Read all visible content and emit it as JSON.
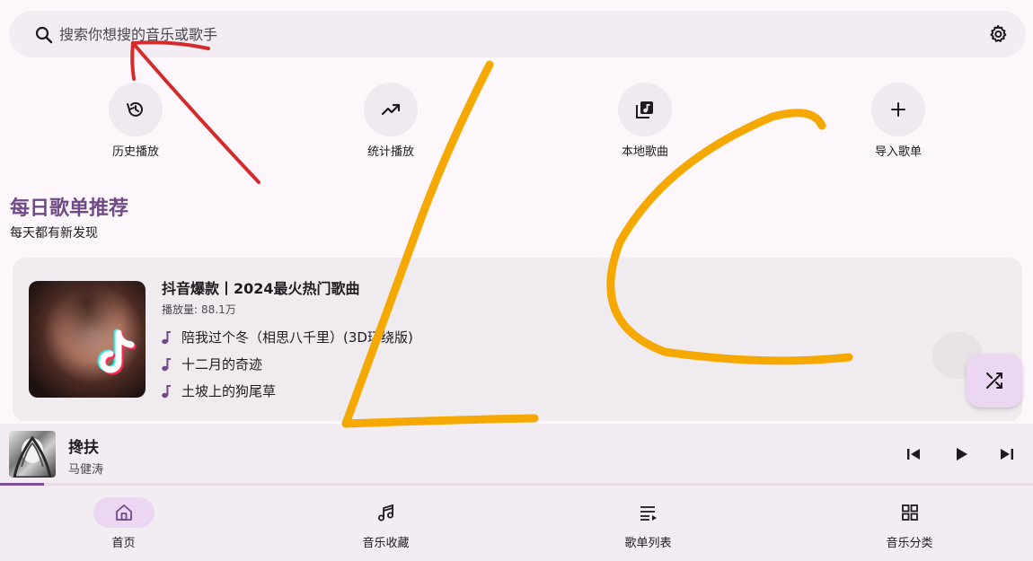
{
  "search": {
    "placeholder": "搜索你想搜的音乐或歌手",
    "icon": "search-icon",
    "settings_icon": "gear-icon"
  },
  "quick_actions": [
    {
      "label": "历史播放",
      "icon": "history-icon"
    },
    {
      "label": "统计播放",
      "icon": "trending-up-icon"
    },
    {
      "label": "本地歌曲",
      "icon": "library-music-icon"
    },
    {
      "label": "导入歌单",
      "icon": "plus-icon"
    }
  ],
  "daily": {
    "title": "每日歌单推荐",
    "subtitle": "每天都有新发现"
  },
  "playlist": {
    "title": "抖音爆款丨2024最火热门歌曲",
    "play_count_label": "播放量:",
    "play_count_value": "88.1万",
    "songs": [
      "陪我过个冬（相思八千里）(3D环绕版)",
      "十二月的奇迹",
      "土坡上的狗尾草"
    ]
  },
  "now_playing": {
    "title": "搀扶",
    "artist": "马健涛",
    "progress": 0.043
  },
  "bottom_nav": [
    {
      "label": "首页",
      "icon": "home-icon",
      "active": true
    },
    {
      "label": "音乐收藏",
      "icon": "music-notes-icon",
      "active": false
    },
    {
      "label": "歌单列表",
      "icon": "playlist-icon",
      "active": false
    },
    {
      "label": "音乐分类",
      "icon": "grid-icon",
      "active": false
    }
  ],
  "colors": {
    "accent": "#6f4a84",
    "fab": "#ecd7f3",
    "surface": "#f3edf3",
    "annotation_red": "#d42a2a",
    "annotation_orange": "#f5a800"
  }
}
